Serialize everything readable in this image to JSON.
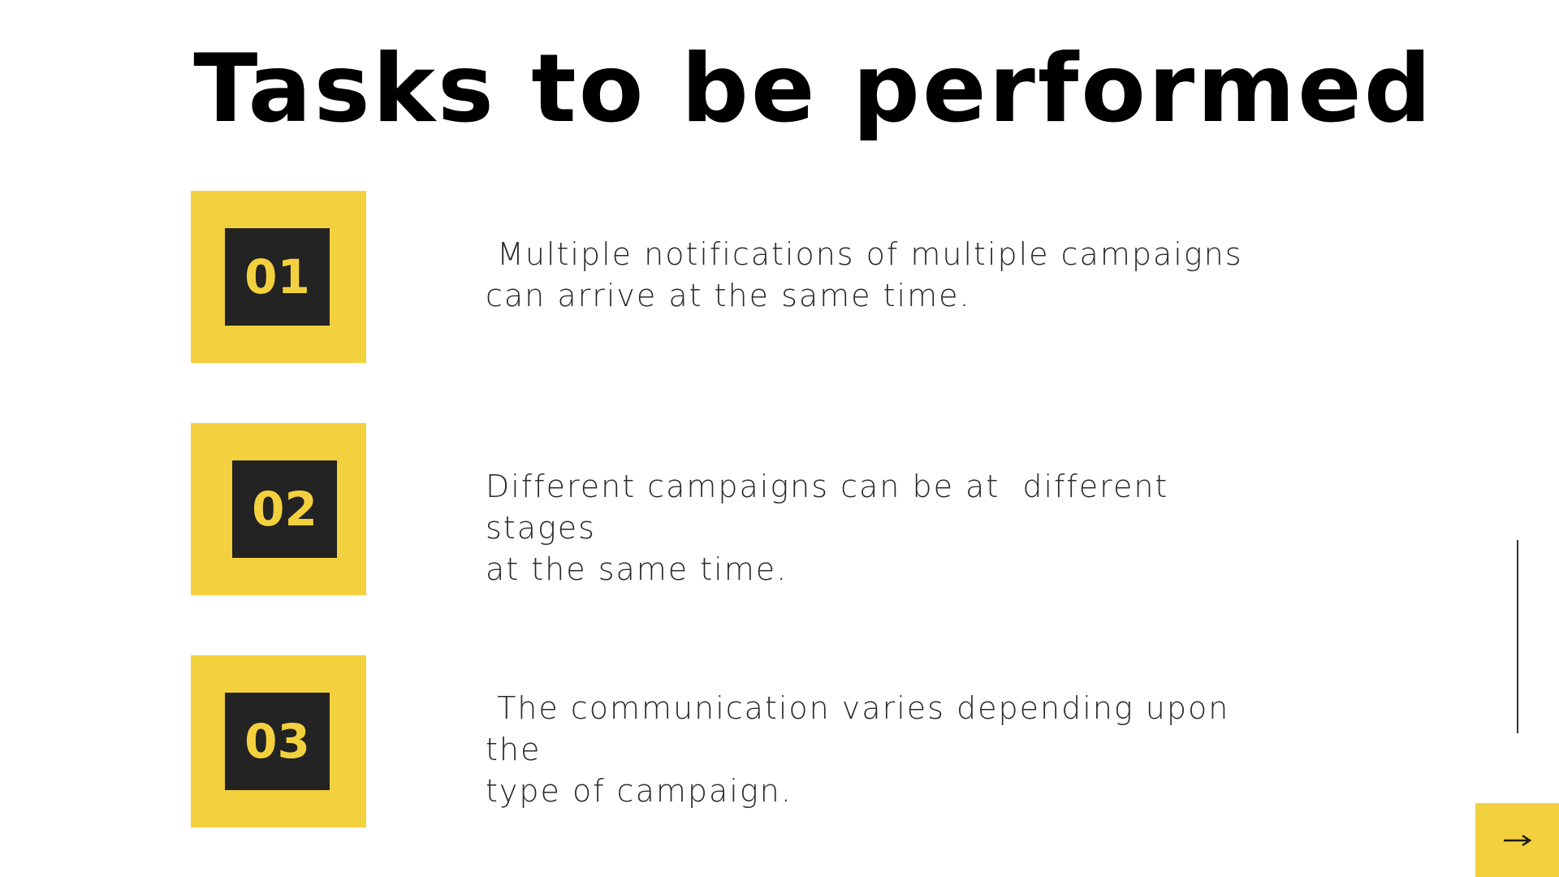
{
  "title": "Tasks to be performed",
  "tasks": [
    {
      "number": "01",
      "text": " Multiple notifications of multiple campaigns\ncan arrive at the same time."
    },
    {
      "number": "02",
      "text": "Different campaigns can be at  different stages\nat the same time."
    },
    {
      "number": "03",
      "text": " The communication varies depending upon the\ntype of campaign."
    }
  ],
  "icons": {
    "next": "arrow-right-icon"
  },
  "colors": {
    "accent": "#f3d03e",
    "badge_dark": "#232323",
    "title": "#000000",
    "text": "#2a2a2a",
    "background": "#ffffff"
  }
}
